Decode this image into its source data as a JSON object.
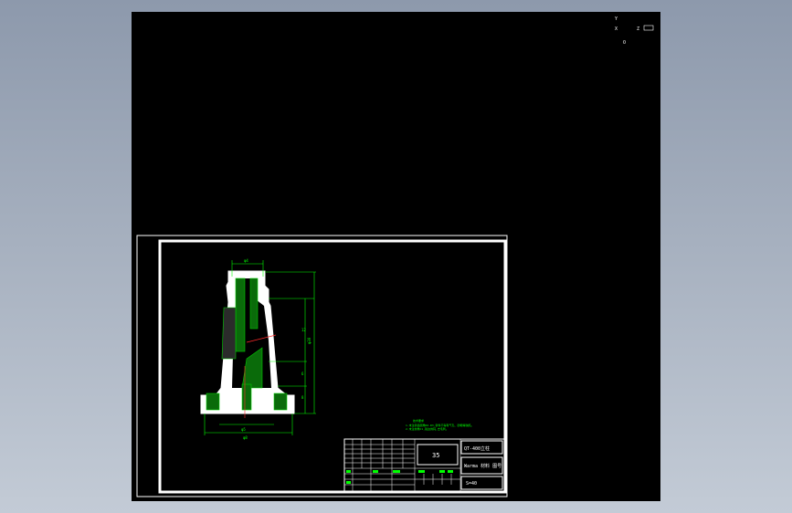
{
  "viewer": {
    "background": "#000000"
  },
  "colors": {
    "outline": "#ffffff",
    "dimension": "#00ff00",
    "hatch": "#00cc00",
    "centerline": "#ff2a2a",
    "note": "#00ff00"
  },
  "drawing": {
    "dims": {
      "top_dia": "φ4",
      "bottom_dia": "φ8",
      "base_dia": "φ5",
      "total_height": "φ30",
      "height_a": "12",
      "height_b": "6",
      "height_c": "8"
    },
    "notes": {
      "title": "技术要求",
      "line1": "1.未注铸造圆角R2-R3,铸件不得有气孔、砂眼等缺陷。",
      "line2": "2.未注倒角C1,锐边倒钝,去毛刺。"
    },
    "title_block": {
      "scale": "35",
      "drawing_name": "QT-400立柱",
      "material": "Warma 材料 图号",
      "number": "S=40"
    }
  },
  "corner_markers": {
    "m1": "Y",
    "m2": "X",
    "m3": "Z",
    "m4": "O"
  }
}
